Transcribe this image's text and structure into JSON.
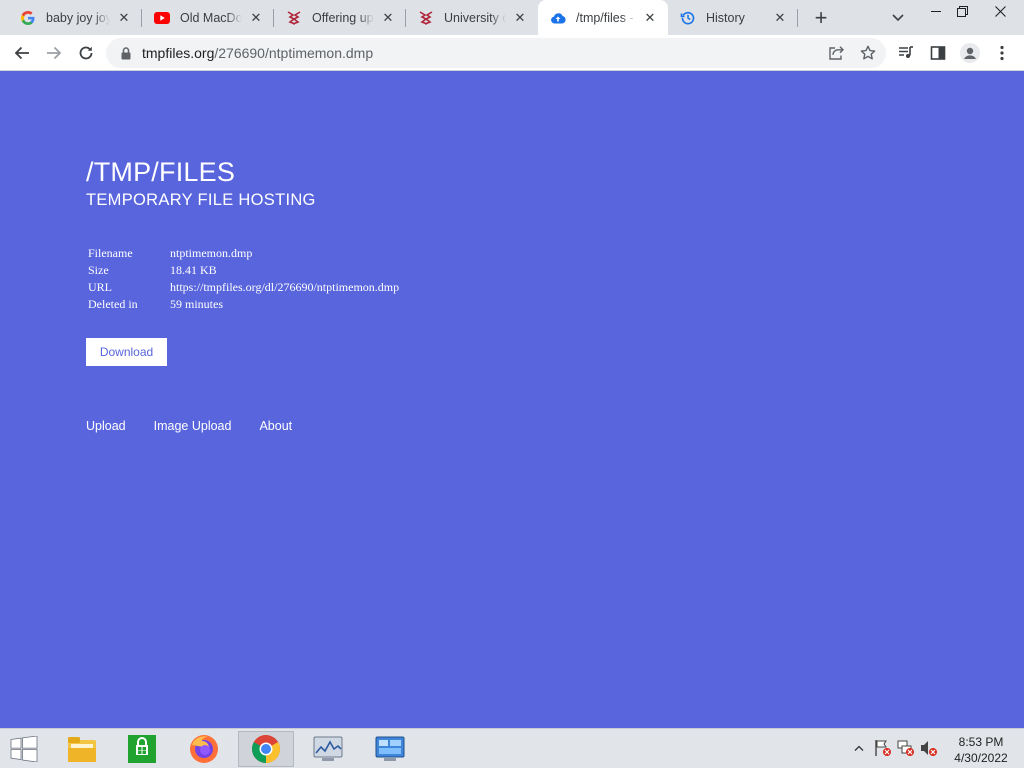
{
  "browser": {
    "tabs": [
      {
        "title": "baby joy joy",
        "icon": "google-icon"
      },
      {
        "title": "Old MacDon",
        "icon": "youtube-icon"
      },
      {
        "title": "Offering up",
        "icon": "university-crest-icon"
      },
      {
        "title": "University of",
        "icon": "university-crest-icon"
      },
      {
        "title": "/tmp/files - c",
        "icon": "cloud-upload-icon",
        "active": true
      },
      {
        "title": "History",
        "icon": "history-icon"
      }
    ],
    "address": {
      "domain": "tmpfiles.org",
      "path": "/276690/ntptimemon.dmp"
    }
  },
  "page": {
    "title": "/TMP/FILES",
    "subtitle": "TEMPORARY FILE HOSTING",
    "info": [
      {
        "label": "Filename",
        "value": "ntptimemon.dmp"
      },
      {
        "label": "Size",
        "value": "18.41 KB"
      },
      {
        "label": "URL",
        "value": "https://tmpfiles.org/dl/276690/ntptimemon.dmp"
      },
      {
        "label": "Deleted in",
        "value": "59 minutes"
      }
    ],
    "download_label": "Download",
    "footer_links": [
      "Upload",
      "Image Upload",
      "About"
    ],
    "background_color": "#5865dc"
  },
  "taskbar": {
    "items": [
      "start-icon",
      "file-explorer-icon",
      "store-icon",
      "firefox-icon",
      "chrome-icon",
      "performance-monitor-icon",
      "control-panel-icon"
    ],
    "time": "8:53 PM",
    "date": "4/30/2022"
  }
}
